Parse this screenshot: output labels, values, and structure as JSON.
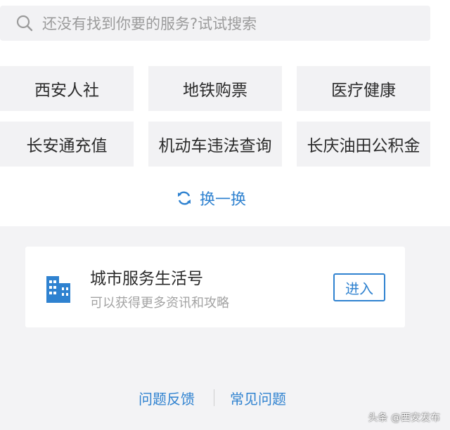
{
  "search": {
    "placeholder": "还没有找到你要的服务?试试搜索",
    "icon": "search-icon"
  },
  "services": [
    {
      "label": "西安人社"
    },
    {
      "label": "地铁购票"
    },
    {
      "label": "医疗健康"
    },
    {
      "label": "长安通充值"
    },
    {
      "label": "机动车违法查询"
    },
    {
      "label": "长庆油田公积金"
    }
  ],
  "refresh": {
    "label": "换一换",
    "icon": "refresh-icon"
  },
  "card": {
    "title": "城市服务生活号",
    "subtitle": "可以获得更多资讯和攻略",
    "button": "进入",
    "icon": "building-icon"
  },
  "footer": {
    "feedback": "问题反馈",
    "faq": "常见问题"
  },
  "watermark": "头条 @西安发布",
  "colors": {
    "accent": "#2f82d0",
    "tile_bg": "#f2f2f4",
    "page_bg": "#f3f3f5"
  }
}
